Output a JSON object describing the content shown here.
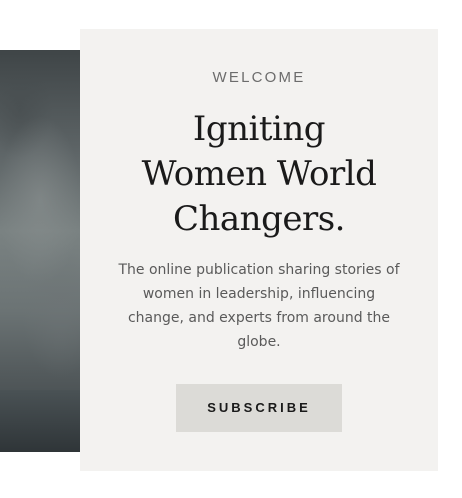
{
  "hero": {
    "eyebrow": "WELCOME",
    "headline_lines": [
      "Igniting",
      "Women World",
      "Changers."
    ],
    "description": "The online publication sharing stories of women in leadership, influencing change, and experts from around the globe.",
    "subscribe_label": "SUBSCRIBE"
  },
  "colors": {
    "card_background": "#f3f2f0",
    "button_background": "#dcdbd7",
    "headline": "#1a1a1a",
    "body_text": "#5a5a5a"
  }
}
